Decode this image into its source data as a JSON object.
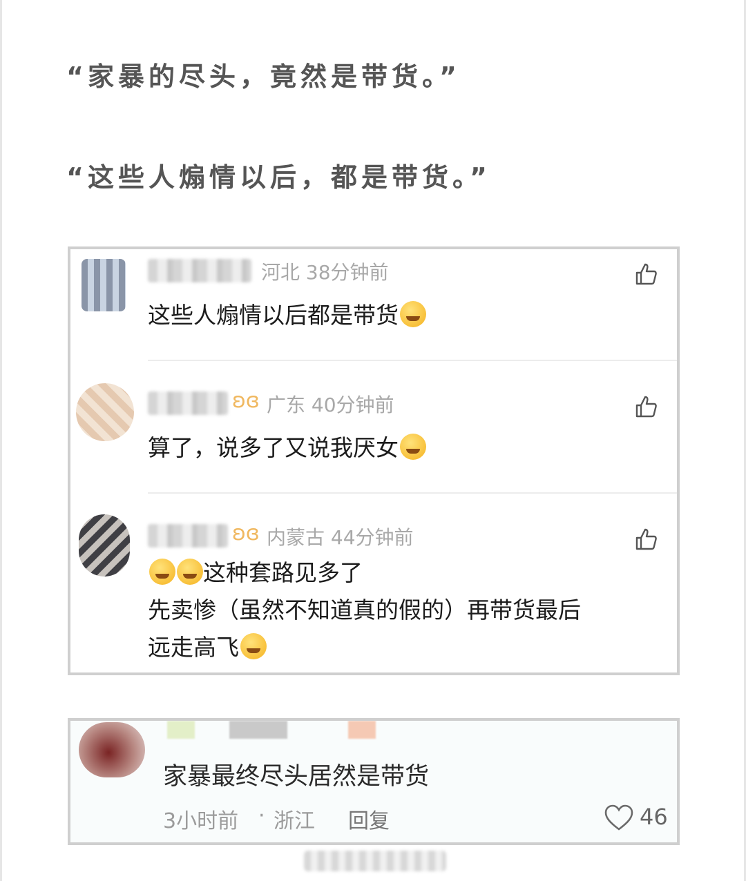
{
  "quotes": [
    "“家暴的尽头，竟然是带货。”",
    "“这些人煽情以后，都是带货。”"
  ],
  "comments": [
    {
      "location": "河北",
      "time": "38分钟前",
      "text": "这些人煽情以后都是带货",
      "emoji": "666-emoji-icon"
    },
    {
      "location": "广东",
      "time": "40分钟前",
      "text": "算了，说多了又说我厌女",
      "emoji": "crying-laugh-icon"
    },
    {
      "location": "内蒙古",
      "time": "44分钟前",
      "line1": "这种套路见多了",
      "line2": "先卖惨（虽然不知道真的假的）再带货最后",
      "line3": "远走高飞"
    }
  ],
  "comment2": {
    "text": "家暴最终尽头居然是带货",
    "time": "3小时前",
    "sep": "·",
    "location": "浙江",
    "reply_label": "回复",
    "likes": "46"
  },
  "colors": {
    "vip": "#f0b860",
    "meta": "#a8a8a8",
    "border": "#cfcfcf"
  },
  "icons": {
    "like": "thumbs-up-icon",
    "heart": "heart-icon",
    "vip": "vip-badge-icon"
  }
}
